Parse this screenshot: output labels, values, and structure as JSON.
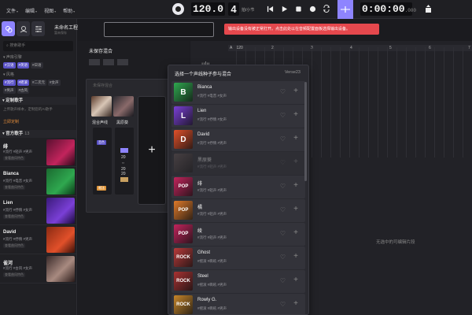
{
  "menu": [
    {
      "label": "文件"
    },
    {
      "label": "编辑"
    },
    {
      "label": "视图"
    },
    {
      "label": "帮助"
    }
  ],
  "transport": {
    "tempo": "120.0",
    "beats": "4",
    "beats_unit": "拍/小节",
    "time_main": "0:00:00",
    "time_ms": ".000"
  },
  "project": {
    "title": "未命名工程",
    "subtitle": "暂未保存"
  },
  "alert": "输出设备没有被正常打开。点击此处以在音频配置面板选择输出设备。",
  "left": {
    "search_placeholder": "搜索歌手",
    "filter_engine": "▾ 声库引擎",
    "filter_style": "▾ 风格",
    "chips_row1": [
      {
        "label": "#汉语",
        "on": true
      },
      {
        "label": "#英语",
        "on": true
      },
      {
        "label": "#日语",
        "on": false
      }
    ],
    "chips_row2": [
      {
        "label": "#流行",
        "on": true
      },
      {
        "label": "#摇滚",
        "on": true
      },
      {
        "label": "#二次元",
        "on": false
      },
      {
        "label": "#女声",
        "on": false
      },
      {
        "label": "#男声",
        "on": false
      },
      {
        "label": "#古风",
        "on": false
      }
    ],
    "custom_section": "▾ 定制歌手",
    "custom_note": "上传歌声样本，定制您的AI歌手",
    "custom_link": "立即定制",
    "official_section": "▾ 官方歌手",
    "official_count": "13",
    "singers": [
      {
        "name": "绯",
        "tags": "#流行 #轻声 #男声",
        "tag2": "查看曲风特色"
      },
      {
        "name": "Bianca",
        "tags": "#流行 #电音 #女声",
        "tag2": "查看曲风特色"
      },
      {
        "name": "Lien",
        "tags": "#流行 #抒情 #女声",
        "tag2": "查看曲风特色"
      },
      {
        "name": "David",
        "tags": "#流行 #抒情 #男声",
        "tag2": "查看曲风特色"
      },
      {
        "name": "雀河",
        "tags": "#流行 #古风 #女声",
        "tag2": "查看曲风特色"
      }
    ]
  },
  "mixer": {
    "title": "未保存混合",
    "card_title": "未保存混合",
    "track1_label": "混合声线",
    "track2_label": "黑原葵",
    "tag_top": "音色",
    "tag_bottom": "唱法",
    "num1": "20",
    "num2": "20",
    "num3": "20",
    "add_symbol": "+"
  },
  "timeline": {
    "ruler_tag": "A",
    "ruler_tag2": "120",
    "ruler_nums": [
      "2",
      "3",
      "4",
      "5",
      "6",
      "7"
    ],
    "empty_text": "无选中的可编辑片段"
  },
  "popup": {
    "title": "选择一个声线种子参与混合",
    "version": "Verse23",
    "voices": [
      {
        "name": "Bianca",
        "tags": "#流行 #电音 #女声",
        "thumb": "bianca-thumb",
        "color": "#2fa84f",
        "glyph": "B",
        "dim": false
      },
      {
        "name": "Lien",
        "tags": "#流行 #抒情 #女声",
        "thumb": "lien-thumb",
        "color": "#7a3fd6",
        "glyph": "L",
        "dim": false
      },
      {
        "name": "David",
        "tags": "#流行 #抒情 #男声",
        "thumb": "david-thumb",
        "color": "#e1502a",
        "glyph": "D",
        "dim": false
      },
      {
        "name": "黑原葵",
        "tags": "#流行 #轻声 #男声",
        "thumb": "kuroharaaoi-thumb",
        "color": "#6a5a5a",
        "glyph": "",
        "dim": true
      },
      {
        "name": "绯",
        "tags": "#流行 #轻声 #男声",
        "thumb": "fei-thumb",
        "color": "#c2245c",
        "glyph": "POP",
        "dim": false
      },
      {
        "name": "橘",
        "tags": "#流行 #轻声 #男声",
        "thumb": "ju-thumb",
        "color": "#e07a2a",
        "glyph": "POP",
        "dim": false
      },
      {
        "name": "绫",
        "tags": "#流行 #轻声 #男声",
        "thumb": "ling-thumb",
        "color": "#c2245c",
        "glyph": "POP",
        "dim": false
      },
      {
        "name": "Ghost",
        "tags": "#摇滚 #嘶吼 #男声",
        "thumb": "ghost-thumb",
        "color": "#b83a3a",
        "glyph": "ROCK",
        "dim": false
      },
      {
        "name": "Steel",
        "tags": "#摇滚 #嘶吼 #男声",
        "thumb": "steel-thumb",
        "color": "#a83232",
        "glyph": "ROCK",
        "dim": false
      },
      {
        "name": "Rowly G.",
        "tags": "#摇滚 #嘶吼 #男声",
        "thumb": "rowly-thumb",
        "color": "#c8872a",
        "glyph": "ROCK",
        "dim": false
      }
    ]
  }
}
